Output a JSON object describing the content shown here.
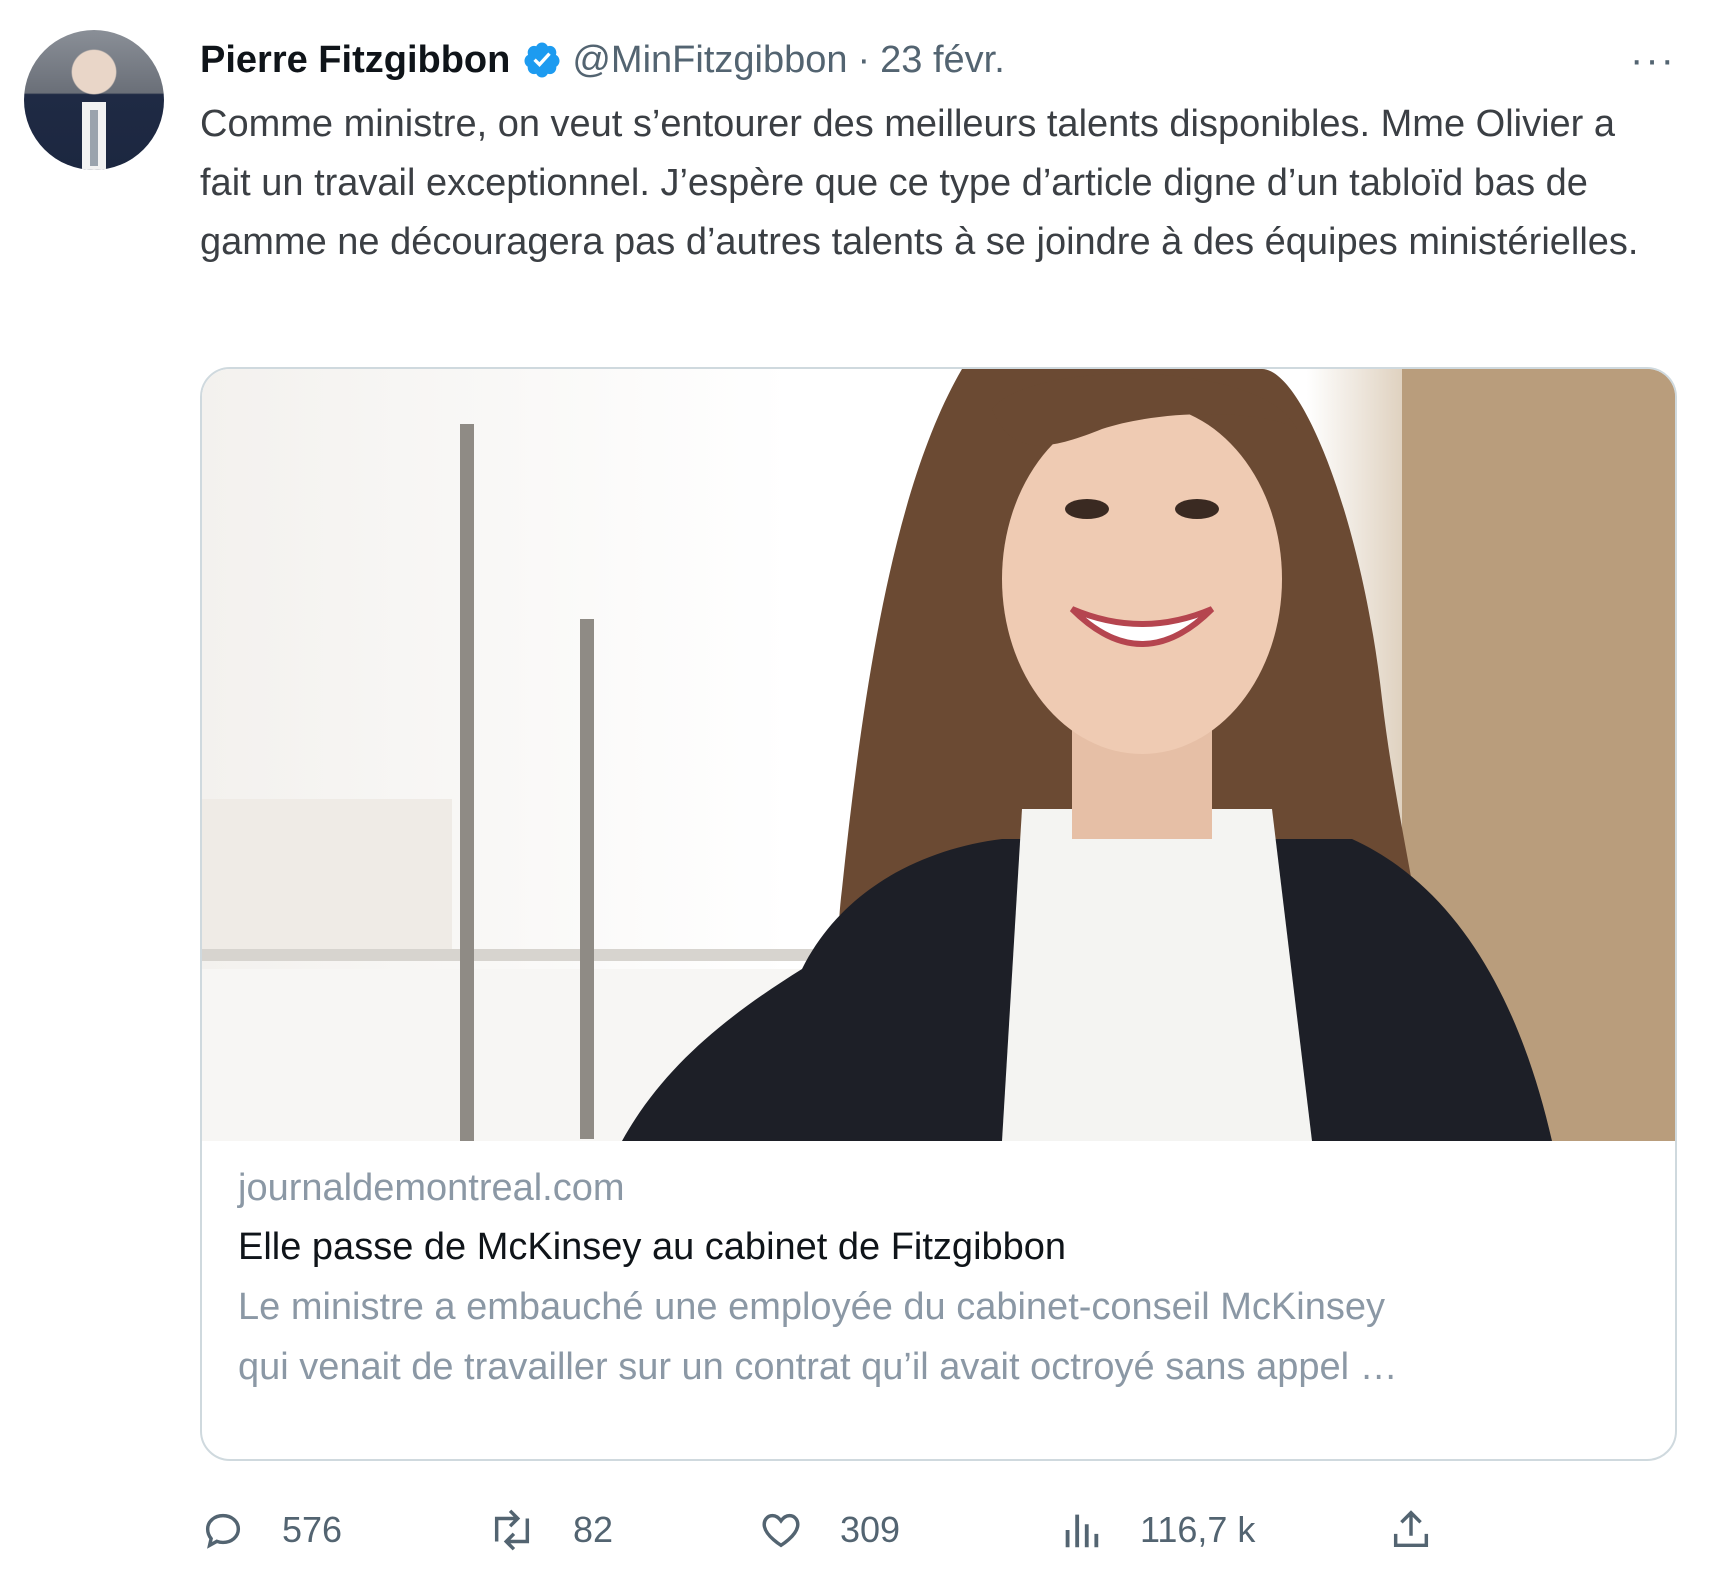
{
  "tweet": {
    "author_name": "Pierre Fitzgibbon",
    "handle": "@MinFitzgibbon",
    "separator": "·",
    "date": "23 févr.",
    "more_label": "···",
    "text": "Comme ministre, on veut s’entourer des meilleurs talents disponibles. Mme Olivier a fait un travail exceptionnel. J’espère que ce type d’article digne d’un tabloïd bas de gamme ne découragera pas d’autres talents à se joindre à des équipes ministérielles."
  },
  "card": {
    "domain": "journaldemontreal.com",
    "title": "Elle passe de McKinsey au cabinet de Fitzgibbon",
    "description": "Le ministre a embauché une employée du cabinet-conseil McKinsey\nqui venait de travailler sur un contrat qu’il avait octroyé sans appel …"
  },
  "actions": {
    "replies": "576",
    "retweets": "82",
    "likes": "309",
    "views": "116,7 k"
  },
  "colors": {
    "verified": "#1d9bf0",
    "secondary_text": "#536471",
    "border": "#cfd9de"
  },
  "icons": [
    "verified-badge-icon",
    "more-icon",
    "reply-icon",
    "retweet-icon",
    "like-icon",
    "views-icon",
    "share-icon"
  ]
}
